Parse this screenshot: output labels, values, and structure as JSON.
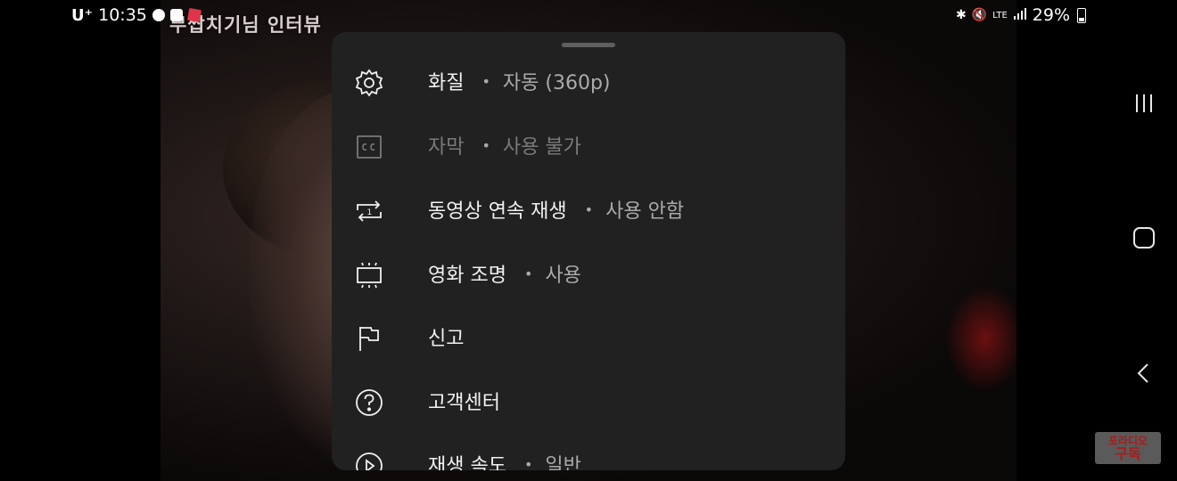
{
  "status_bar": {
    "carrier": "U⁺",
    "time": "10:35",
    "network": "LTE",
    "battery": "29%"
  },
  "video": {
    "title": "무쌉치기님 인터뷰"
  },
  "watermark": {
    "line1": "포라디오",
    "line2": "구독"
  },
  "menu": {
    "items": [
      {
        "icon": "gear-icon",
        "label": "화질",
        "separator": "•",
        "value": "자동 (360p)",
        "enabled": true
      },
      {
        "icon": "captions-icon",
        "label": "자막",
        "separator": "•",
        "value": "사용 불가",
        "enabled": false
      },
      {
        "icon": "autoplay-loop-icon",
        "label": "동영상 연속 재생",
        "separator": "•",
        "value": "사용 안함",
        "enabled": true
      },
      {
        "icon": "ambient-mode-icon",
        "label": "영화 조명",
        "separator": "•",
        "value": "사용",
        "enabled": true
      },
      {
        "icon": "flag-icon",
        "label": "신고",
        "separator": "",
        "value": "",
        "enabled": true
      },
      {
        "icon": "help-icon",
        "label": "고객센터",
        "separator": "",
        "value": "",
        "enabled": true
      },
      {
        "icon": "play-speed-icon",
        "label": "재생 속도",
        "separator": "•",
        "value": "일반",
        "enabled": true
      }
    ]
  },
  "colors": {
    "sheet_bg": "#212121",
    "label": "#f1f1f1",
    "value": "#aaaaaa",
    "disabled": "#7a7a7a"
  }
}
